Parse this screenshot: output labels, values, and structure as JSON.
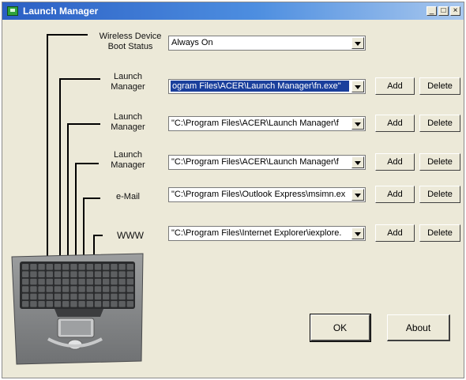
{
  "window": {
    "title": "Launch Manager",
    "controls": {
      "minimize": "_",
      "maximize": "□",
      "close": "×"
    }
  },
  "rows": [
    {
      "id": "wireless",
      "label_lines": [
        "Wireless Device",
        "Boot Status"
      ],
      "value": "Always On",
      "selected": false,
      "has_buttons": false
    },
    {
      "id": "launch1",
      "label_lines": [
        "Launch",
        "Manager"
      ],
      "value": "ogram Files\\ACER\\Launch Manager\\fn.exe\"",
      "selected": true,
      "has_buttons": true
    },
    {
      "id": "launch2",
      "label_lines": [
        "Launch",
        "Manager"
      ],
      "value": "\"C:\\Program Files\\ACER\\Launch Manager\\f",
      "selected": false,
      "has_buttons": true
    },
    {
      "id": "launch3",
      "label_lines": [
        "Launch",
        "Manager"
      ],
      "value": "\"C:\\Program Files\\ACER\\Launch Manager\\f",
      "selected": false,
      "has_buttons": true
    },
    {
      "id": "email",
      "label_lines": [
        "e-Mail"
      ],
      "value": "\"C:\\Program Files\\Outlook Express\\msimn.ex",
      "selected": false,
      "has_buttons": true
    },
    {
      "id": "www",
      "label_lines": [
        "WWW"
      ],
      "value": "\"C:\\Program Files\\Internet Explorer\\iexplore.",
      "selected": false,
      "has_buttons": true
    }
  ],
  "buttons": {
    "add": "Add",
    "delete": "Delete",
    "ok": "OK",
    "about": "About"
  },
  "colors": {
    "titlebar_start": "#2b5fc4",
    "titlebar_end": "#a9c8ee",
    "dialog_bg": "#ece9d8",
    "selection": "#1a3f9c"
  },
  "image": {
    "name": "laptop-keyboard-illustration"
  }
}
